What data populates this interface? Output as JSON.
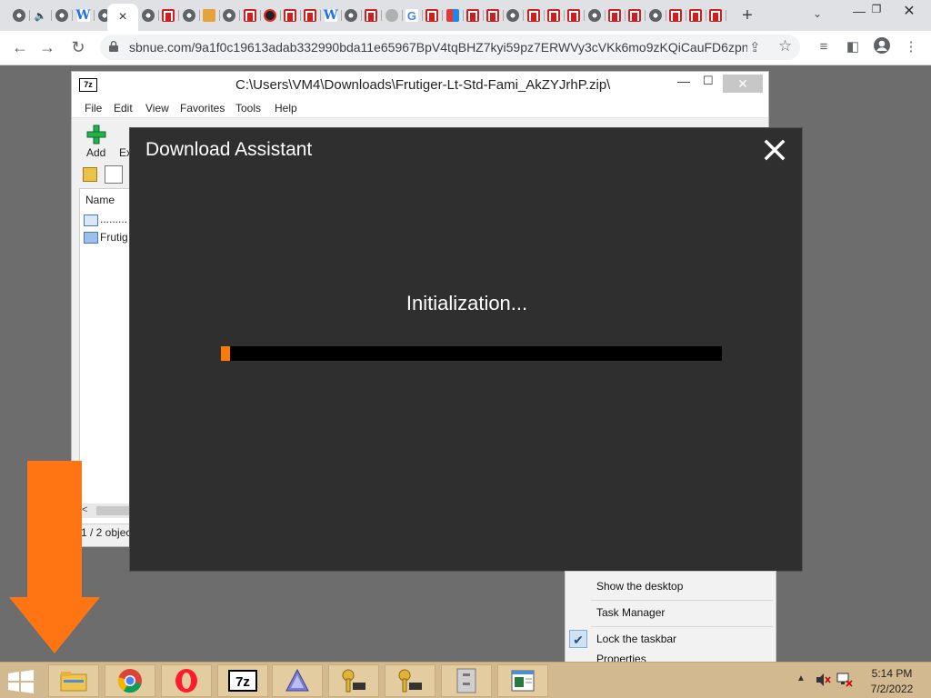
{
  "browser": {
    "tabs": [
      "globe",
      "speaker",
      "globe",
      "wiki",
      "globe",
      "active",
      "globe",
      "red",
      "globe",
      "photo",
      "globe",
      "red",
      "dark",
      "red",
      "red",
      "wiki",
      "globe",
      "red",
      "grey",
      "google",
      "red",
      "puzzle",
      "red",
      "red",
      "globe",
      "red",
      "red",
      "red",
      "globe",
      "red",
      "red",
      "globe",
      "red",
      "red",
      "red"
    ],
    "active_tab_close": "×",
    "new_tab": "+",
    "tab_search": "⌄",
    "window_min": "—",
    "window_restore": "❐",
    "window_close": "✕",
    "url": "sbnue.com/9a1f0c19613adab332990bda11e65967BpV4tqBHZ7kyi59pz7ERWVy3cVKk6mo9zKQiCauFD6zpn...",
    "back": "←",
    "forward": "→",
    "reload": "↻",
    "share": "⇪",
    "star": "☆",
    "media": "≡",
    "sidepanel": "◧",
    "menu": "⋮"
  },
  "sevenzip": {
    "logo": "7z",
    "title": "C:\\Users\\VM4\\Downloads\\Frutiger-Lt-Std-Fami_AkZYJrhP.zip\\",
    "minimize": "—",
    "maximize": "☐",
    "close": "✕",
    "menu": [
      "File",
      "Edit",
      "View",
      "Favorites",
      "Tools",
      "Help"
    ],
    "toolbar": {
      "add": "Add",
      "extract": "Ex"
    },
    "list": {
      "column_name": "Name",
      "rows": [
        ".........",
        "Frutig"
      ]
    },
    "scroll_left": "<",
    "status": "1 / 2 object"
  },
  "modal": {
    "title": "Download Assistant",
    "status": "Initialization...",
    "progress_fraction": 0.018,
    "accent": "#ff7a00",
    "background": "#2f2f2f"
  },
  "context_menu": {
    "items": [
      "Show the desktop",
      "Task Manager",
      "Lock the taskbar",
      "Properties"
    ],
    "checked": "✔"
  },
  "taskbar": {
    "apps": [
      "file-explorer",
      "chrome",
      "opera",
      "7zip",
      "prism",
      "key-tool",
      "key-tool-2",
      "archive",
      "notepad"
    ],
    "clock_time": "5:14 PM",
    "clock_date": "7/2/2022",
    "tray_arrow": "▲"
  },
  "colors": {
    "taskbar": "#d3b98f",
    "desktop": "#6d6d6d",
    "arrow": "#ff7514"
  }
}
